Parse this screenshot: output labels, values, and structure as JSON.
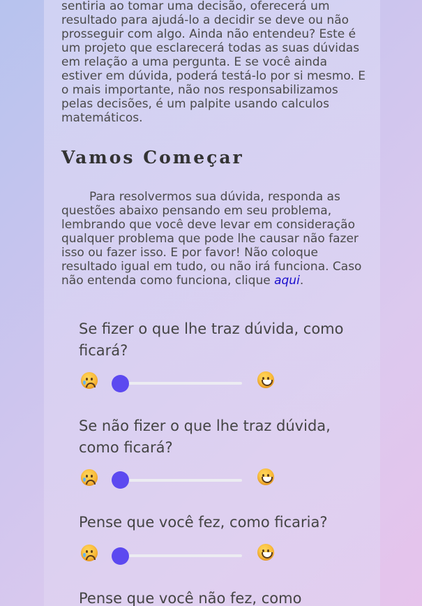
{
  "intro_text": "considerando suas emoções e como você se sentiria ao tomar uma decisão, oferecerá um resultado para ajudá-lo a decidir se deve ou não prosseguir com algo. Ainda não entendeu? Este é um projeto que esclarecerá todas as suas dúvidas em relação a uma pergunta. E se você ainda estiver em dúvida, poderá testá-lo por si mesmo. E o mais importante, não nos responsabilizamos pelas decisões, é um palpite usando calculos matemáticos.",
  "section_title": "Vamos Começar",
  "instructions": {
    "text": "Para resolvermos sua dúvida, responda as questões abaixo pensando em seu problema, lembrando que você deve levar em consideração qualquer problema que pode lhe causar não fazer isso ou fazer isso. E por favor! Não coloque resultado igual em tudo, ou não irá funciona. Caso não entenda como funciona, clique ",
    "link_label": "aqui",
    "suffix": "."
  },
  "questions": [
    {
      "label": "Se fizer o que lhe traz dúvida, como ficará?",
      "value": 0,
      "min_icon": "crying-face-icon",
      "max_icon": "grinning-face-icon"
    },
    {
      "label": "Se não fizer o que lhe traz dúvida, como ficará?",
      "value": 0,
      "min_icon": "crying-face-icon",
      "max_icon": "grinning-face-icon"
    },
    {
      "label": "Pense que você fez, como ficaria?",
      "value": 0,
      "min_icon": "crying-face-icon",
      "max_icon": "grinning-face-icon"
    },
    {
      "label": "Pense que você não fez, como"
    }
  ],
  "colors": {
    "accent": "#5c49f0",
    "link": "#1a0dcc"
  }
}
